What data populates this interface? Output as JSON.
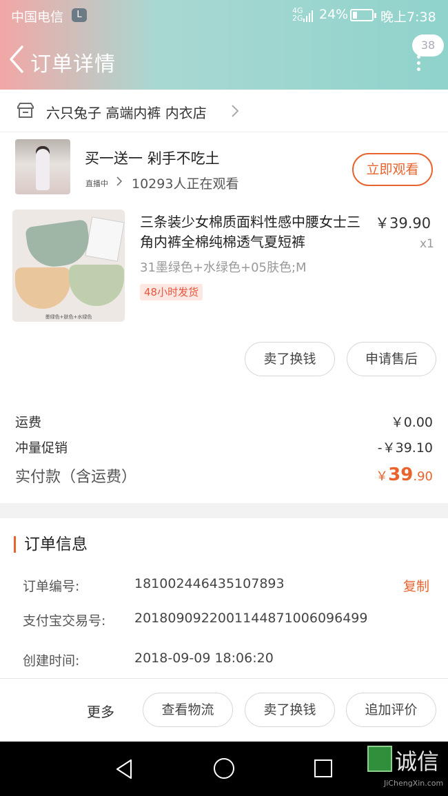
{
  "status_bar": {
    "carrier": "中国电信",
    "carrier_icon": "L",
    "network": "4G\n2G",
    "battery_pct": "24%",
    "battery_level": 0.24,
    "time": "晚上7:38"
  },
  "nav": {
    "title": "订单详情",
    "badge": "38"
  },
  "shop": {
    "name": "六只兔子 高端内裤 内衣店"
  },
  "live": {
    "title": "买一送一 剁手不吃土",
    "tag": "直播中",
    "watching": "10293人正在观看",
    "button": "立即观看"
  },
  "product": {
    "title": "三条装少女棉质面料性感中腰女士三角内裤全棉纯棉透气夏短裤",
    "price": "￥39.90",
    "qty": "x1",
    "sku": "31墨绿色+水绿色+05肤色;M",
    "shipping_tag": "48小时发货",
    "image_caption": "墨绿色+肤色+水绿色"
  },
  "item_actions": {
    "sell": "卖了换钱",
    "after_sale": "申请售后"
  },
  "fees": {
    "shipping_label": "运费",
    "shipping_value": "￥0.00",
    "promo_label": "冲量促销",
    "promo_value": "-￥39.10",
    "total_label": "实付款（含运费）",
    "total_currency": "￥",
    "total_int": "39",
    "total_dec": ".90"
  },
  "order_info": {
    "heading": "订单信息",
    "order_no_label": "订单编号:",
    "order_no": "1810024464351078​93",
    "copy": "复制",
    "alipay_label": "支付宝交易号:",
    "alipay_no": "2018090922001144871006096499",
    "created_label": "创建时间:",
    "created": "2018-09-09 18:06:20"
  },
  "bottom_actions": {
    "more": "更多",
    "logistics": "查看物流",
    "sell": "卖了换钱",
    "review": "追加评价"
  },
  "watermark": {
    "text": "诚信",
    "url": "JiChengXin.com"
  },
  "colors": {
    "accent": "#e8632d",
    "header_teal": "#8fd3cc",
    "header_pink": "#f2a7a5"
  }
}
